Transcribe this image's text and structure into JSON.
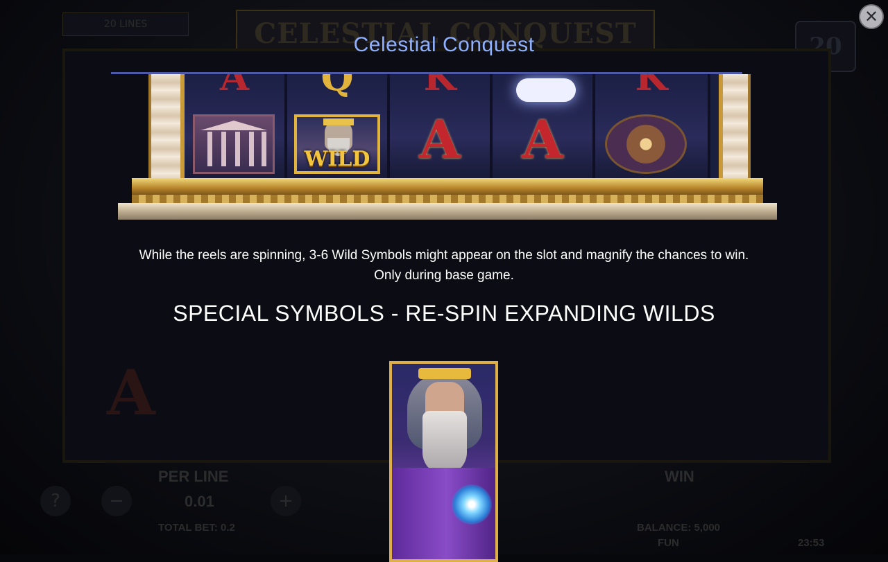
{
  "window": {
    "close_symbol": "✕"
  },
  "background_game": {
    "logo_text": "CELESTIAL CONQUEST",
    "lines_label": "20 LINES",
    "lines_count": "20",
    "per_line_label": "PER LINE",
    "per_line_value": "0.01",
    "total_bet": "TOTAL BET: 0.2",
    "win_label": "WIN",
    "balance": "BALANCE: 5,000",
    "mode": "FUN",
    "time": "23:53",
    "minus_symbol": "−",
    "plus_symbol": "+",
    "help_symbol": "?"
  },
  "info_panel": {
    "title": "Celestial Conquest",
    "description_line1": "While the reels are spinning, 3-6 Wild Symbols might appear on the slot and magnify the chances to win.",
    "description_line2": "Only during base game.",
    "section_heading": "SPECIAL SYMBOLS - RE-SPIN EXPANDING WILDS"
  },
  "example_reels": {
    "top_letters": [
      "A",
      "Q",
      "K",
      "",
      "K"
    ],
    "wild_label": "WILD",
    "big_letters": [
      "A",
      "A"
    ]
  },
  "icons": {
    "close": "close-icon",
    "help": "help-icon",
    "minus": "minus-icon",
    "plus": "plus-icon"
  },
  "colors": {
    "title": "#8fb0ff",
    "rule": "#4d58a8",
    "gold": "#e0b048",
    "text": "#ffffff"
  }
}
